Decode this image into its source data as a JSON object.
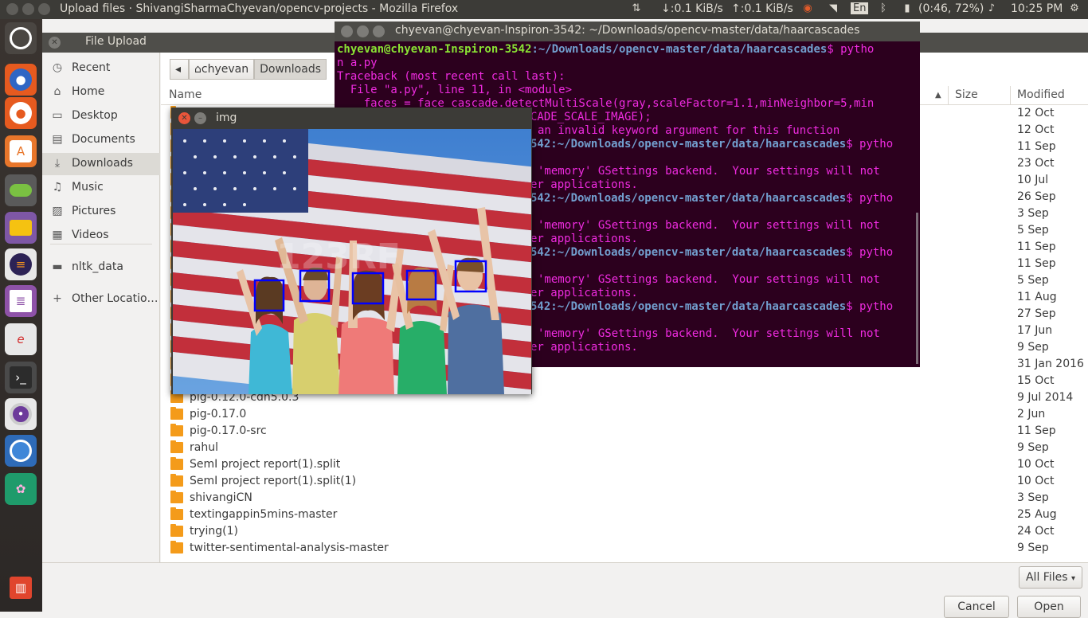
{
  "top_panel": {
    "window_title": "Upload files · ShivangiSharmaChyevan/opencv-projects - Mozilla Firefox",
    "net_down": "↓:0.1 KiB/s",
    "net_up": "↑:0.1 KiB/s",
    "keyboard": "En",
    "battery": "(0:46, 72%)",
    "clock": "10:25 PM"
  },
  "launcher": {
    "items": [
      {
        "name": "ubuntu-dash-icon"
      },
      {
        "name": "firefox-icon"
      },
      {
        "name": "firefox-alt-icon"
      },
      {
        "name": "software-center-icon"
      },
      {
        "name": "settings-toggle-icon"
      },
      {
        "name": "files-icon"
      },
      {
        "name": "eclipse-icon"
      },
      {
        "name": "text-editor-icon"
      },
      {
        "name": "editor-e-icon"
      },
      {
        "name": "terminal-icon"
      },
      {
        "name": "disc-burner-icon"
      },
      {
        "name": "chromium-icon"
      },
      {
        "name": "system-settings-icon"
      },
      {
        "name": "trash-icon"
      }
    ]
  },
  "file_dialog": {
    "title": "File Upload",
    "places": [
      {
        "label": "Recent",
        "icon": "clock-icon"
      },
      {
        "label": "Home",
        "icon": "home-icon"
      },
      {
        "label": "Desktop",
        "icon": "desktop-icon"
      },
      {
        "label": "Documents",
        "icon": "documents-icon"
      },
      {
        "label": "Downloads",
        "icon": "downloads-icon",
        "active": true
      },
      {
        "label": "Music",
        "icon": "music-icon"
      },
      {
        "label": "Pictures",
        "icon": "pictures-icon"
      },
      {
        "label": "Videos",
        "icon": "videos-icon"
      }
    ],
    "bookmarks": [
      {
        "label": "nltk_data",
        "icon": "folder-icon"
      }
    ],
    "other_locations": "Other Locatio…",
    "pathbar": {
      "home": "chyevan",
      "current": "Downloads"
    },
    "columns": {
      "name": "Name",
      "size": "Size",
      "modified": "Modified"
    },
    "rows": [
      {
        "name": "",
        "modified": "12 Oct"
      },
      {
        "name": "",
        "modified": "12 Oct"
      },
      {
        "name": "",
        "modified": "11 Sep"
      },
      {
        "name": "",
        "modified": "23 Oct"
      },
      {
        "name": "",
        "modified": "10 Jul"
      },
      {
        "name": "",
        "modified": "26 Sep"
      },
      {
        "name": "",
        "modified": "3 Sep"
      },
      {
        "name": "",
        "modified": "5 Sep"
      },
      {
        "name": "",
        "modified": "11 Sep"
      },
      {
        "name": "",
        "modified": "11 Sep"
      },
      {
        "name": "",
        "modified": "5 Sep"
      },
      {
        "name": "",
        "modified": "11 Aug"
      },
      {
        "name": "",
        "modified": "27 Sep"
      },
      {
        "name": "",
        "modified": "17 Jun"
      },
      {
        "name": "",
        "modified": "9 Sep"
      },
      {
        "name": "",
        "modified": "31 Jan 2016"
      },
      {
        "name": "",
        "modified": "15 Oct"
      },
      {
        "name": "pig-0.12.0-cdh5.0.3",
        "modified": "9 Jul 2014"
      },
      {
        "name": "pig-0.17.0",
        "modified": "2 Jun"
      },
      {
        "name": "pig-0.17.0-src",
        "modified": "11 Sep"
      },
      {
        "name": "rahul",
        "modified": "9 Sep"
      },
      {
        "name": "SemI project report(1).split",
        "modified": "10 Oct"
      },
      {
        "name": "SemI project report(1).split(1)",
        "modified": "10 Oct"
      },
      {
        "name": "shivangiCN",
        "modified": "3 Sep"
      },
      {
        "name": "textingappin5mins-master",
        "modified": "25 Aug"
      },
      {
        "name": "trying(1)",
        "modified": "24 Oct"
      },
      {
        "name": "twitter-sentimental-analysis-master",
        "modified": "9 Sep"
      }
    ],
    "filter": "All Files",
    "cancel": "Cancel",
    "open": "Open"
  },
  "terminal": {
    "title": "chyevan@chyevan-Inspiron-3542: ~/Downloads/opencv-master/data/haarcascades",
    "prompt_user": "chyevan@chyevan-Inspiron-3542",
    "prompt_path": ":~/Downloads/opencv-master/data/haarcascades",
    "prompt_dollar": "$ pytho",
    "cmd_wrap": "n a.py",
    "tb1": "Traceback (most recent call last):",
    "tb2": "  File \"a.py\", line 11, in <module>",
    "tb3": "    faces = face_cascade.detectMultiScale(gray,scaleFactor=1.1,minNeighbor=5,min",
    "tb4": "CADE_SCALE_IMAGE);",
    "tb5": "an invalid keyword argument for this function",
    "path_tail": "542:~/Downloads/opencv-master/data/haarcascades",
    "gs1": "'memory' GSettings backend.  Your settings will not",
    "gs2": "er applications."
  },
  "img_window": {
    "title": "img"
  },
  "colors": {
    "terminal_bg": "#2c001e",
    "terminal_text": "#ef2be0",
    "prompt_green": "#8ae234",
    "prompt_blue": "#729fcf",
    "folder": "#f49b1a",
    "face_box": "#0000ff"
  }
}
